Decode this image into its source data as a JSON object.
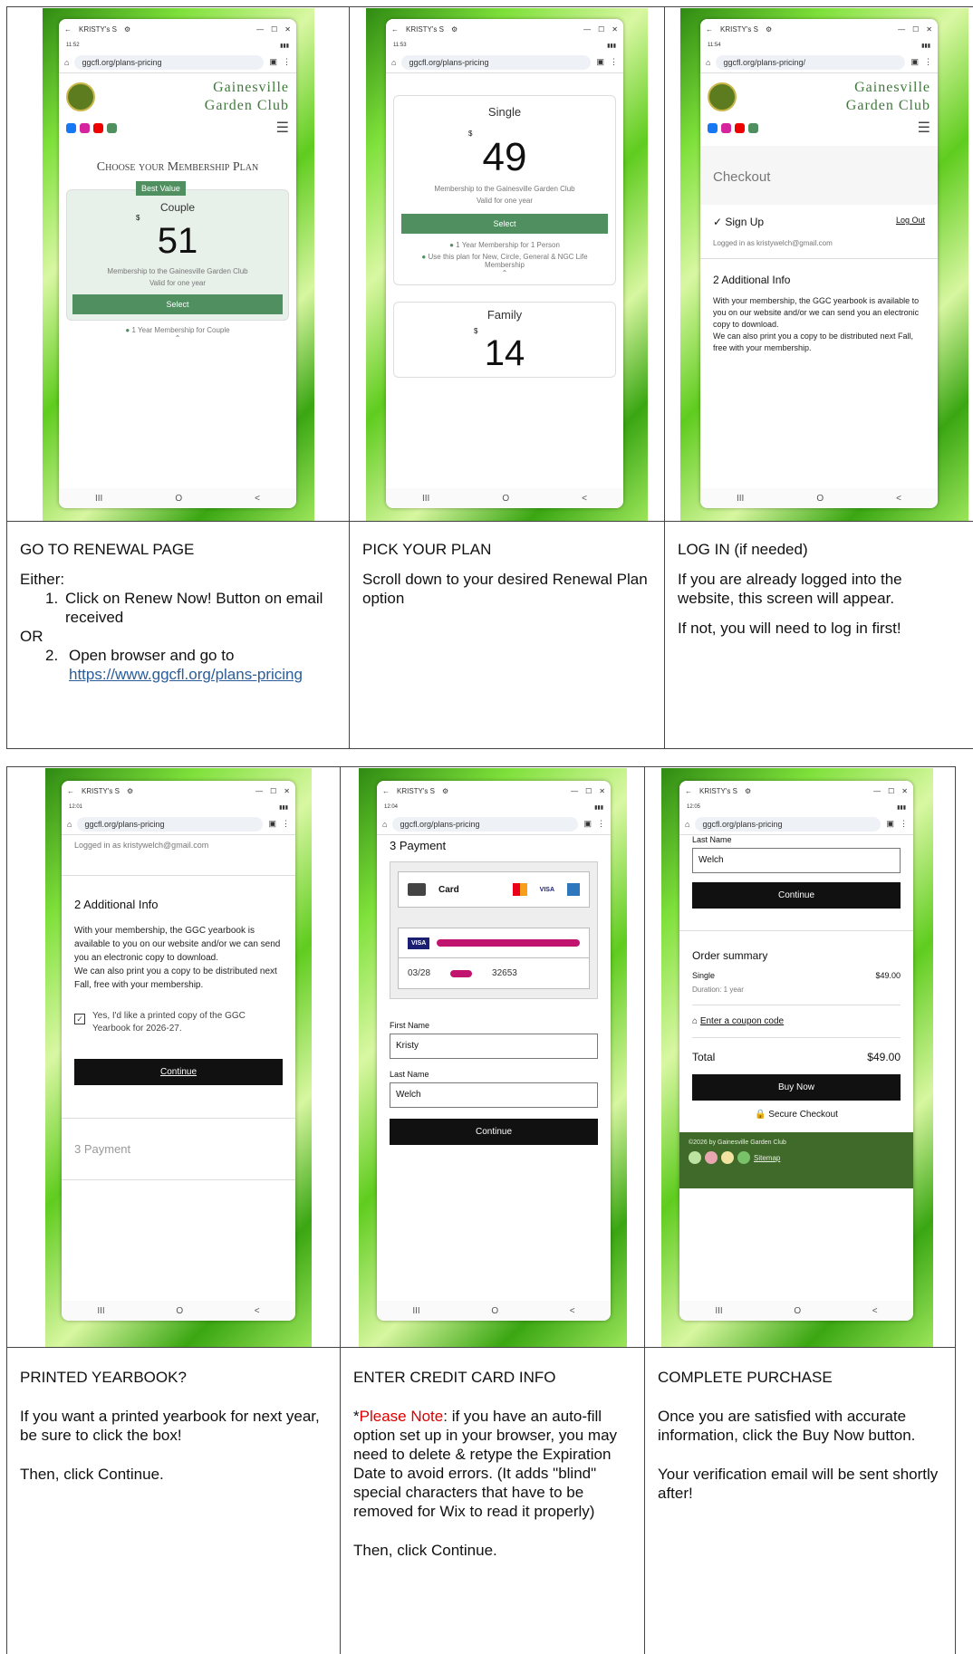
{
  "phone": {
    "tab_title": "KRISTY's S",
    "nav_glyphs": [
      "III",
      "O",
      "<"
    ]
  },
  "panels": [
    {
      "time": "11:52",
      "url": "ggcfl.org/plans-pricing",
      "heading": "Choose your Membership Plan",
      "badge": "Best Value",
      "plan_name": "Couple",
      "price_sign": "$",
      "price": "51",
      "desc": "Membership to the Gainesville Garden Club",
      "valid": "Valid for one year",
      "select": "Select",
      "feature": "1 Year Membership for Couple",
      "brand_line1": "Gainesville",
      "brand_line2": "Garden Club"
    },
    {
      "time": "11:53",
      "url": "ggcfl.org/plans-pricing",
      "plan_name": "Single",
      "price_sign": "$",
      "price": "49",
      "desc": "Membership to the Gainesville Garden Club",
      "valid": "Valid for one year",
      "select": "Select",
      "features": [
        "1 Year Membership for 1 Person",
        "Use this plan for New, Circle, General & NGC Life Membership"
      ],
      "plan2": "Family",
      "price2": "14"
    },
    {
      "time": "11:54",
      "url": "ggcfl.org/plans-pricing/",
      "checkout": "Checkout",
      "signup": "Sign Up",
      "logout": "Log Out",
      "logged": "Logged in as kristywelch@gmail.com",
      "addl": "2  Additional Info",
      "info": "With your membership, the GGC yearbook is available to you on our website and/or we can send you an electronic copy to download.\nWe can also print you a copy to be distributed next Fall, free with your membership.",
      "brand_line1": "Gainesville",
      "brand_line2": "Garden Club"
    },
    {
      "time": "12:01",
      "url": "ggcfl.org/plans-pricing",
      "logged": "Logged in as kristywelch@gmail.com",
      "addl": "2  Additional Info",
      "info": "With your membership, the GGC yearbook is available to you on our website and/or we can send you an electronic copy to download.\nWe can also print you a copy to be distributed next Fall, free with your membership.",
      "check": "Yes, I'd like a printed copy of the GGC Yearbook for 2026-27.",
      "continue": "Continue",
      "payment": "3  Payment"
    },
    {
      "time": "12:04",
      "url": "ggcfl.org/plans-pricing",
      "payment": "3  Payment",
      "card": "Card",
      "expiry": "03/28",
      "zip": "32653",
      "first_label": "First Name",
      "first_val": "Kristy",
      "last_label": "Last Name",
      "last_val": "Welch",
      "continue": "Continue"
    },
    {
      "time": "12:05",
      "url": "ggcfl.org/plans-pricing",
      "last_label": "Last Name",
      "last_val": "Welch",
      "continue": "Continue",
      "summary": "Order summary",
      "item": "Single",
      "item_price": "$49.00",
      "duration": "Duration: 1 year",
      "coupon": "Enter a coupon code",
      "total": "Total",
      "total_price": "$49.00",
      "buy": "Buy Now",
      "secure": "Secure Checkout",
      "footer": "©2026 by Gainesville Garden Club",
      "sitemap": "Sitemap"
    }
  ],
  "captions": [
    {
      "title": "GO TO RENEWAL PAGE",
      "either": "Either:",
      "step1_num": "1.",
      "step1": "Click on Renew Now! Button on email received",
      "or": "OR",
      "step2_num": "2.",
      "step2": "Open browser and go to",
      "link": "https://www.ggcfl.org/plans-pricing"
    },
    {
      "title": "PICK YOUR PLAN",
      "body": "Scroll down to your desired Renewal Plan option"
    },
    {
      "title": "LOG IN (if needed)",
      "body": "If you are already logged into the website, this screen will appear.",
      "body2": "If not, you will need to log in first!"
    },
    {
      "title": "PRINTED YEARBOOK?",
      "body": "If you want a printed yearbook for next year, be sure to click the box!",
      "body2": "Then, click Continue."
    },
    {
      "title": "ENTER CREDIT CARD INFO",
      "star": "*",
      "note": "Please Note",
      "body": ": if you have an auto-fill option set up in your browser, you may need to delete & retype the Expiration Date to avoid errors. (It adds \"blind\" special characters that have to be removed for Wix to read it properly)",
      "body2": "Then, click Continue."
    },
    {
      "title": "COMPLETE PURCHASE",
      "body": "Once you are satisfied with accurate information, click the Buy Now button.",
      "body2": "Your verification email will be sent shortly after!"
    }
  ]
}
